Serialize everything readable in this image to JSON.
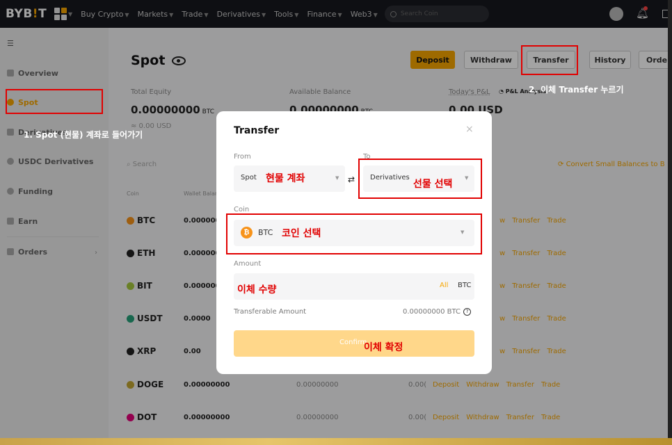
{
  "nav": {
    "logo_main": "BYB",
    "logo_accent": "!",
    "logo_end": "T",
    "items": [
      "Buy Crypto",
      "Markets",
      "Trade",
      "Derivatives",
      "Tools",
      "Finance",
      "Web3"
    ],
    "search_placeholder": "Search Coin"
  },
  "sidebar": {
    "items": [
      "Overview",
      "Spot",
      "Derivatives",
      "USDC Derivatives",
      "Funding",
      "Earn",
      "Orders"
    ]
  },
  "page": {
    "title": "Spot",
    "buttons": {
      "deposit": "Deposit",
      "withdraw": "Withdraw",
      "transfer": "Transfer",
      "history": "History",
      "orders": "Order"
    },
    "total_equity_label": "Total Equity",
    "total_equity_value": "0.00000000",
    "total_equity_unit": "BTC",
    "total_equity_usd": "≈ 0.00 USD",
    "available_label": "Available Balance",
    "available_value": "0.00000000",
    "available_unit": "BTC",
    "pnl_label": "Today's P&L",
    "pnl_analysis": "P&L Analysis",
    "pnl_value": "0.00 USD",
    "search_placeholder": "Search",
    "convert_label": "Convert Small Balances to B",
    "headers": [
      "Coin",
      "Wallet Balance"
    ]
  },
  "coins": [
    {
      "name": "BTC",
      "balance": "0.000000",
      "available": "",
      "col3": "",
      "color": "#f7931a",
      "actions": [
        "w",
        "Transfer",
        "Trade"
      ]
    },
    {
      "name": "ETH",
      "balance": "0.000000",
      "available": "",
      "col3": "",
      "color": "#222222",
      "actions": [
        "w",
        "Transfer",
        "Trade"
      ]
    },
    {
      "name": "BIT",
      "balance": "0.000000",
      "available": "",
      "col3": "",
      "color": "#a6c93e",
      "actions": [
        "w",
        "Transfer",
        "Trade"
      ]
    },
    {
      "name": "USDT",
      "balance": "0.0000",
      "available": "",
      "col3": "",
      "color": "#26a17b",
      "actions": [
        "w",
        "Transfer",
        "Trade"
      ]
    },
    {
      "name": "XRP",
      "balance": "0.00",
      "available": "",
      "col3": "",
      "color": "#222222",
      "actions": [
        "w",
        "Transfer",
        "Trade"
      ]
    },
    {
      "name": "DOGE",
      "balance": "0.00000000",
      "available": "0.00000000",
      "col3": "0.00(",
      "color": "#c2a633",
      "actions": [
        "Deposit",
        "Withdraw",
        "Transfer",
        "Trade"
      ]
    },
    {
      "name": "DOT",
      "balance": "0.00000000",
      "available": "0.00000000",
      "col3": "0.00(",
      "color": "#e6007a",
      "actions": [
        "Deposit",
        "Withdraw",
        "Transfer",
        "Trade"
      ]
    }
  ],
  "modal": {
    "title": "Transfer",
    "close": "×",
    "from_label": "From",
    "from_value": "Spot",
    "to_label": "To",
    "to_value": "Derivatives",
    "coin_label": "Coin",
    "coin_value": "BTC",
    "amount_label": "Amount",
    "all_label": "All",
    "amount_unit": "BTC",
    "transferable_label": "Transferable Amount",
    "transferable_value": "0.00000000 BTC",
    "confirm_label": "Confirm"
  },
  "annotations": {
    "step1": "1. Spot (현물) 계좌로 들어가기",
    "step2": "2. 이체 Transfer 누르기",
    "spot_account": "현물 계좌",
    "select_futures": "선물 선택",
    "select_coin": "코인 선택",
    "amount": "이체 수량",
    "confirm": "이체 확정"
  }
}
